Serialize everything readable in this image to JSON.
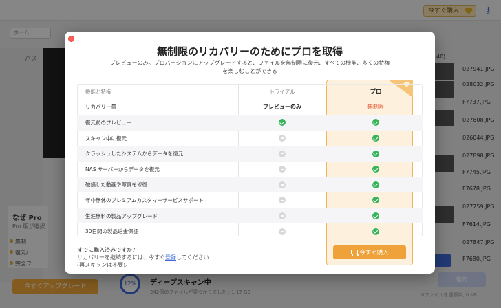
{
  "background": {
    "buy_button": "今すぐ購入",
    "nav_label": "ホーム",
    "path_label": "パス",
    "pro_title": "なぜ Pro",
    "pro_sub": "Pro 版が選択",
    "pro_items": [
      "無制",
      "復元/",
      "完全フ"
    ],
    "upgrade_button": "今すぐアップグレード",
    "scan_percent": "12%",
    "scan_title": "ディープスキャン中",
    "scan_sub": "242個のファイルが見つかりました : 1.17 GB",
    "file_count": "40)",
    "files": [
      "027941.JPG",
      "028032.JPG",
      "F7737.JPG",
      "027808.JPG",
      "026044.JPG",
      "027898.JPG",
      "F7745.JPG",
      "F7678.JPG",
      "027759.JPG",
      "F7614.JPG",
      "027847.JPG",
      "F7680.JPG"
    ],
    "footer_text": "0ファイルを選択中, 0 KB",
    "recover_button": "復元"
  },
  "modal": {
    "title": "無制限のリカバリーのためにプロを取得",
    "description": "プレビューのみ。プロバージョンにアップグレードすると、ファイルを無制限に復元、すべての機能、多くの特権を楽しむことができる",
    "header": {
      "feature": "機能と特権",
      "trial": "トライアル",
      "pro": "プロ"
    },
    "rows": [
      {
        "feature": "リカバリー量",
        "trial": "プレビューのみ",
        "pro": "無制限"
      },
      {
        "feature": "復元前のプレビュー",
        "trial": "check",
        "pro": "check"
      },
      {
        "feature": "スキャン中に復元",
        "trial": "none",
        "pro": "check"
      },
      {
        "feature": "クラッシュしたシステムからデータを復元",
        "trial": "none",
        "pro": "check"
      },
      {
        "feature": "NAS サーバーからデータを復元",
        "trial": "none",
        "pro": "check"
      },
      {
        "feature": "破損した動画や写真を修復",
        "trial": "none",
        "pro": "check"
      },
      {
        "feature": "年中無休のプレミアムカスタマーサービスサポート",
        "trial": "none",
        "pro": "check"
      },
      {
        "feature": "生涯無料の製品アップグレード",
        "trial": "none",
        "pro": "check"
      },
      {
        "feature": "30日間の製品返金保証",
        "trial": "none",
        "pro": "check"
      }
    ],
    "bottom": {
      "question": "すでに購入済みですか？",
      "line2_pre": "リカバリーを継続するには、今すぐ",
      "line2_link": "登録",
      "line2_post": "してください",
      "line3": "(再スキャンは不要)。",
      "buy_button": "今すぐ購入"
    }
  }
}
